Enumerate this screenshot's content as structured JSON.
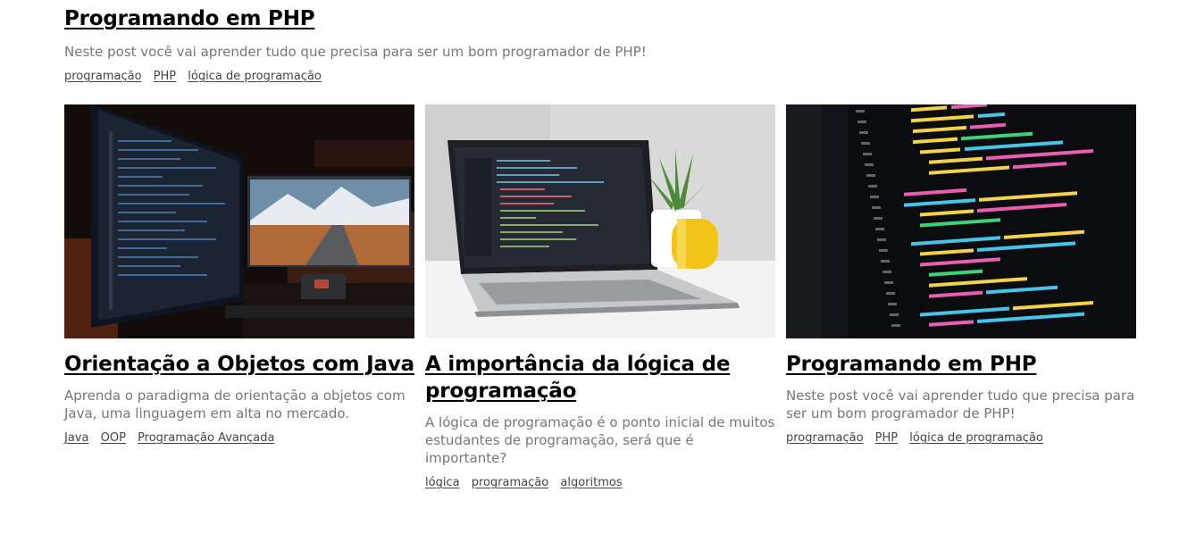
{
  "featured": {
    "title": "Programando em PHP",
    "description": "Neste post você vai aprender tudo que precisa para ser um bom programador de PHP!",
    "tags": [
      "programação",
      "PHP",
      "lógica de programação"
    ]
  },
  "cards": [
    {
      "title": "Orientação a Objetos com Java",
      "description": "Aprenda o paradigma de orientação a objetos com Java, uma linguagem em alta no mercado.",
      "tags": [
        "Java",
        "OOP",
        "Programação Avançada"
      ],
      "image": "dual-monitor-setup"
    },
    {
      "title": "A importância da lógica de programação",
      "description": "A lógica de programação é o ponto inicial de muitos estudantes de programação, será que é importante?",
      "tags": [
        "lógica",
        "programação",
        "algoritmos"
      ],
      "image": "laptop-with-code"
    },
    {
      "title": "Programando em PHP",
      "description": "Neste post você vai aprender tudo que precisa para ser um bom programador de PHP!",
      "tags": [
        "programação",
        "PHP",
        "lógica de programação"
      ],
      "image": "code-closeup"
    }
  ]
}
